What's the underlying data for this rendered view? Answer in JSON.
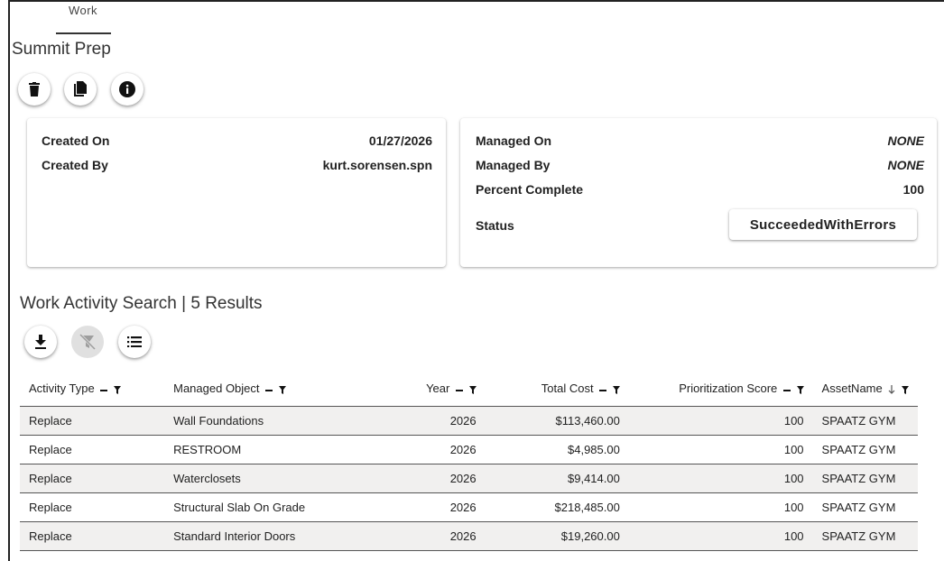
{
  "tab": {
    "label": "Work"
  },
  "page": {
    "title": "Summit Prep"
  },
  "actions": {
    "delete": {
      "icon": "trash-icon"
    },
    "copy": {
      "icon": "copy-icon"
    },
    "info": {
      "icon": "info-icon"
    }
  },
  "created_card": {
    "created_on_label": "Created On",
    "created_on_value": "01/27/2026",
    "created_by_label": "Created By",
    "created_by_value": "kurt.sorensen.spn"
  },
  "managed_card": {
    "managed_on_label": "Managed On",
    "managed_on_value": "NONE",
    "managed_by_label": "Managed By",
    "managed_by_value": "NONE",
    "percent_label": "Percent Complete",
    "percent_value": "100",
    "status_label": "Status",
    "status_value": "SucceededWithErrors"
  },
  "search": {
    "title": "Work Activity Search | 5 Results",
    "toolbar": {
      "download": {
        "icon": "download-icon"
      },
      "clear_filter": {
        "icon": "filter-off-icon",
        "disabled": true
      },
      "columns": {
        "icon": "list-icon"
      }
    },
    "columns": [
      {
        "label": "Activity Type",
        "sort": "none"
      },
      {
        "label": "Managed Object",
        "sort": "none"
      },
      {
        "label": "Year",
        "sort": "none"
      },
      {
        "label": "Total Cost",
        "sort": "none"
      },
      {
        "label": "Prioritization Score",
        "sort": "none"
      },
      {
        "label": "AssetName",
        "sort": "descending"
      }
    ],
    "rows": [
      [
        "Replace",
        "Wall Foundations",
        "2026",
        "$113,460.00",
        "100",
        "SPAATZ GYM"
      ],
      [
        "Replace",
        "RESTROOM",
        "2026",
        "$4,985.00",
        "100",
        "SPAATZ GYM"
      ],
      [
        "Replace",
        "Waterclosets",
        "2026",
        "$9,414.00",
        "100",
        "SPAATZ GYM"
      ],
      [
        "Replace",
        "Structural Slab On Grade",
        "2026",
        "$218,485.00",
        "100",
        "SPAATZ GYM"
      ],
      [
        "Replace",
        "Standard Interior Doors",
        "2026",
        "$19,260.00",
        "100",
        "SPAATZ GYM"
      ]
    ]
  },
  "colors": {
    "row_shade": "#f1f0ef",
    "border": "#555555",
    "disabled": "#e0e0e0"
  }
}
